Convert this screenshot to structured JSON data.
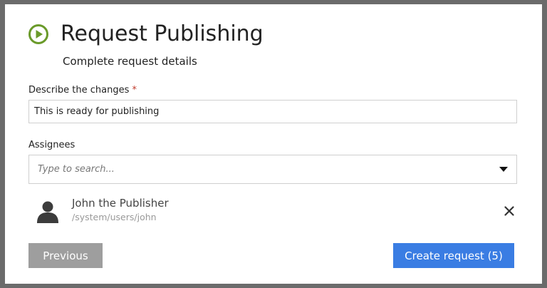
{
  "dialog": {
    "title": "Request Publishing",
    "subtitle": "Complete request details"
  },
  "colors": {
    "accent_green": "#6a9a2a",
    "primary_blue": "#3a7de3",
    "secondary_gray": "#9e9e9e",
    "required_red": "#c0392b"
  },
  "icons": {
    "title": "play-circle-icon",
    "dropdown": "caret-down-icon",
    "avatar": "user-silhouette-icon",
    "remove": "close-icon"
  },
  "description": {
    "label": "Describe the changes",
    "required_marker": "*",
    "value": "This is ready for publishing"
  },
  "assignees": {
    "label": "Assignees",
    "search_placeholder": "Type to search...",
    "items": [
      {
        "name": "John the Publisher",
        "path": "/system/users/john"
      }
    ]
  },
  "buttons": {
    "previous": "Previous",
    "create": "Create request (5)"
  }
}
